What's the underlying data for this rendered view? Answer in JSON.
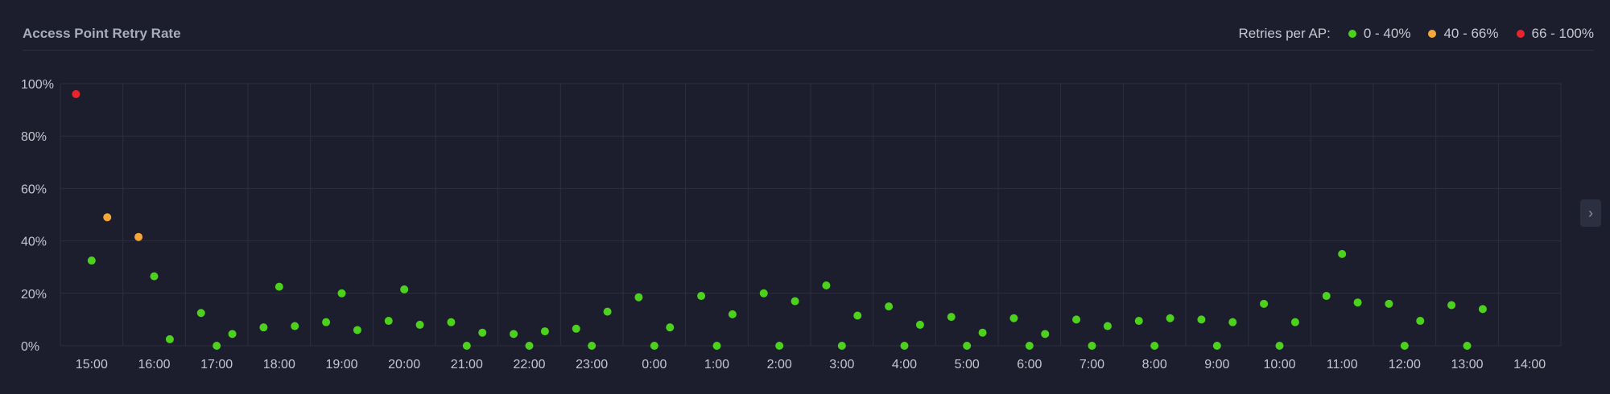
{
  "header": {
    "title": "Access Point Retry Rate",
    "legend_label": "Retries per AP:",
    "legend": [
      {
        "label": "0 - 40%",
        "color": "#4cd21c"
      },
      {
        "label": "40 - 66%",
        "color": "#f7a63a"
      },
      {
        "label": "66 - 100%",
        "color": "#e8242c"
      }
    ]
  },
  "nav": {
    "icon": "chevron-right-icon",
    "glyph": "›"
  },
  "chart_data": {
    "type": "scatter",
    "title": "Access Point Retry Rate",
    "xlabel": "",
    "ylabel": "",
    "ylim": [
      0,
      100
    ],
    "y_ticks": [
      0,
      20,
      40,
      60,
      80,
      100
    ],
    "y_tick_labels": [
      "0%",
      "20%",
      "40%",
      "60%",
      "80%",
      "100%"
    ],
    "x_tick_labels": [
      "15:00",
      "16:00",
      "17:00",
      "18:00",
      "19:00",
      "20:00",
      "21:00",
      "22:00",
      "23:00",
      "0:00",
      "1:00",
      "2:00",
      "3:00",
      "4:00",
      "5:00",
      "6:00",
      "7:00",
      "8:00",
      "9:00",
      "10:00",
      "11:00",
      "12:00",
      "13:00",
      "14:00"
    ],
    "xlim": [
      -0.5,
      23.5
    ],
    "grid": true,
    "legend_position": "top-right",
    "series": [
      {
        "name": "0 - 40%",
        "color": "#4cd21c",
        "points": [
          [
            0.0,
            32.5
          ],
          [
            1.0,
            26.5
          ],
          [
            1.25,
            2.5
          ],
          [
            1.75,
            12.5
          ],
          [
            2.0,
            0
          ],
          [
            2.25,
            4.5
          ],
          [
            2.75,
            7
          ],
          [
            3.0,
            22.5
          ],
          [
            3.25,
            7.5
          ],
          [
            3.75,
            9
          ],
          [
            4.0,
            20
          ],
          [
            4.25,
            6
          ],
          [
            4.75,
            9.5
          ],
          [
            5.0,
            21.5
          ],
          [
            5.25,
            8
          ],
          [
            5.75,
            9
          ],
          [
            6.0,
            0
          ],
          [
            6.25,
            5
          ],
          [
            6.75,
            4.5
          ],
          [
            7.0,
            0
          ],
          [
            7.25,
            5.5
          ],
          [
            7.75,
            6.5
          ],
          [
            8.0,
            0
          ],
          [
            8.25,
            13
          ],
          [
            8.75,
            18.5
          ],
          [
            9.0,
            0
          ],
          [
            9.25,
            7
          ],
          [
            9.75,
            19
          ],
          [
            10.0,
            0
          ],
          [
            10.25,
            12
          ],
          [
            10.75,
            20
          ],
          [
            11.0,
            0
          ],
          [
            11.25,
            17
          ],
          [
            11.75,
            23
          ],
          [
            12.0,
            0
          ],
          [
            12.25,
            11.5
          ],
          [
            12.75,
            15
          ],
          [
            13.0,
            0
          ],
          [
            13.25,
            8
          ],
          [
            13.75,
            11
          ],
          [
            14.0,
            0
          ],
          [
            14.25,
            5
          ],
          [
            14.75,
            10.5
          ],
          [
            15.0,
            0
          ],
          [
            15.25,
            4.5
          ],
          [
            15.75,
            10
          ],
          [
            16.0,
            0
          ],
          [
            16.25,
            7.5
          ],
          [
            16.75,
            9.5
          ],
          [
            17.0,
            0
          ],
          [
            17.25,
            10.5
          ],
          [
            17.75,
            10
          ],
          [
            18.0,
            0
          ],
          [
            18.25,
            9
          ],
          [
            18.75,
            16
          ],
          [
            19.0,
            0
          ],
          [
            19.25,
            9
          ],
          [
            19.75,
            19
          ],
          [
            20.0,
            35
          ],
          [
            20.25,
            16.5
          ],
          [
            20.75,
            16
          ],
          [
            21.0,
            0
          ],
          [
            21.25,
            9.5
          ],
          [
            21.75,
            15.5
          ],
          [
            22.0,
            0
          ],
          [
            22.25,
            14
          ]
        ]
      },
      {
        "name": "40 - 66%",
        "color": "#f7a63a",
        "points": [
          [
            0.25,
            49
          ],
          [
            0.75,
            41.5
          ]
        ]
      },
      {
        "name": "66 - 100%",
        "color": "#e8242c",
        "points": [
          [
            -0.25,
            96
          ]
        ]
      }
    ]
  }
}
